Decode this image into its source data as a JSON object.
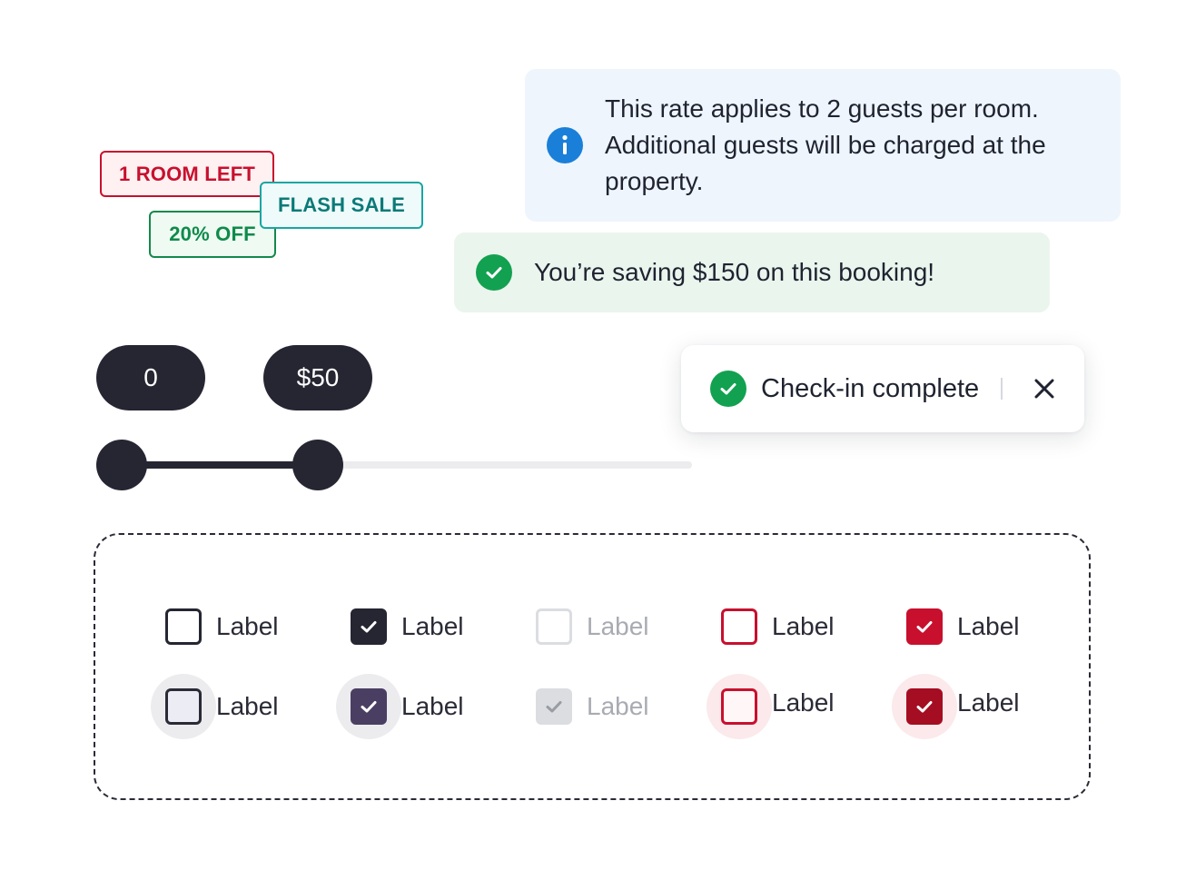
{
  "tags": {
    "room_left": "1 ROOM LEFT",
    "discount": "20% OFF",
    "flash_sale": "FLASH SALE"
  },
  "info_banner": {
    "icon": "info-icon",
    "line1": "This rate applies to 2 guests per room.",
    "line2": "Additional guests will be charged at the",
    "line3": "property."
  },
  "success_banner": {
    "icon": "check-circle-icon",
    "text": "You’re saving $150 on this booking!"
  },
  "toast": {
    "icon": "check-circle-icon",
    "text": "Check-in complete",
    "close_icon": "close-icon"
  },
  "price_slider": {
    "min_label": "0",
    "max_label": "$50",
    "range_min_value": 0,
    "range_max_value": 50,
    "selected_fraction": 0.345
  },
  "checkboxes": {
    "row1": [
      {
        "label": "Label",
        "state": "unchecked",
        "variant": "default"
      },
      {
        "label": "Label",
        "state": "checked",
        "variant": "default"
      },
      {
        "label": "Label",
        "state": "unchecked",
        "variant": "disabled"
      },
      {
        "label": "Label",
        "state": "unchecked",
        "variant": "error"
      },
      {
        "label": "Label",
        "state": "checked",
        "variant": "error"
      }
    ],
    "row2": [
      {
        "label": "Label",
        "state": "unchecked",
        "variant": "hover"
      },
      {
        "label": "Label",
        "state": "checked",
        "variant": "hover"
      },
      {
        "label": "Label",
        "state": "checked",
        "variant": "disabled"
      },
      {
        "label": "Label",
        "state": "unchecked",
        "variant": "error-hover"
      },
      {
        "label": "Label",
        "state": "checked",
        "variant": "error-hover"
      }
    ]
  },
  "colors": {
    "dark": "#252632",
    "success": "#12a150",
    "info": "#1a7fd8",
    "error": "#c8102e",
    "error_dark": "#a50d22",
    "teal": "#1aa6a3"
  }
}
